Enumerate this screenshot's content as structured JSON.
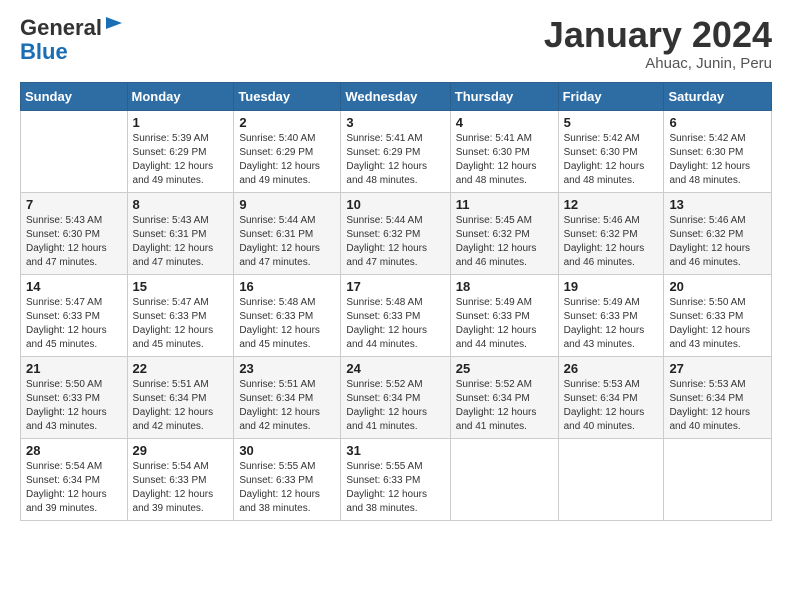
{
  "logo": {
    "general": "General",
    "blue": "Blue"
  },
  "title": "January 2024",
  "location": "Ahuac, Junin, Peru",
  "days_header": [
    "Sunday",
    "Monday",
    "Tuesday",
    "Wednesday",
    "Thursday",
    "Friday",
    "Saturday"
  ],
  "weeks": [
    [
      {
        "num": "",
        "info": ""
      },
      {
        "num": "1",
        "info": "Sunrise: 5:39 AM\nSunset: 6:29 PM\nDaylight: 12 hours\nand 49 minutes."
      },
      {
        "num": "2",
        "info": "Sunrise: 5:40 AM\nSunset: 6:29 PM\nDaylight: 12 hours\nand 49 minutes."
      },
      {
        "num": "3",
        "info": "Sunrise: 5:41 AM\nSunset: 6:29 PM\nDaylight: 12 hours\nand 48 minutes."
      },
      {
        "num": "4",
        "info": "Sunrise: 5:41 AM\nSunset: 6:30 PM\nDaylight: 12 hours\nand 48 minutes."
      },
      {
        "num": "5",
        "info": "Sunrise: 5:42 AM\nSunset: 6:30 PM\nDaylight: 12 hours\nand 48 minutes."
      },
      {
        "num": "6",
        "info": "Sunrise: 5:42 AM\nSunset: 6:30 PM\nDaylight: 12 hours\nand 48 minutes."
      }
    ],
    [
      {
        "num": "7",
        "info": "Sunrise: 5:43 AM\nSunset: 6:30 PM\nDaylight: 12 hours\nand 47 minutes."
      },
      {
        "num": "8",
        "info": "Sunrise: 5:43 AM\nSunset: 6:31 PM\nDaylight: 12 hours\nand 47 minutes."
      },
      {
        "num": "9",
        "info": "Sunrise: 5:44 AM\nSunset: 6:31 PM\nDaylight: 12 hours\nand 47 minutes."
      },
      {
        "num": "10",
        "info": "Sunrise: 5:44 AM\nSunset: 6:32 PM\nDaylight: 12 hours\nand 47 minutes."
      },
      {
        "num": "11",
        "info": "Sunrise: 5:45 AM\nSunset: 6:32 PM\nDaylight: 12 hours\nand 46 minutes."
      },
      {
        "num": "12",
        "info": "Sunrise: 5:46 AM\nSunset: 6:32 PM\nDaylight: 12 hours\nand 46 minutes."
      },
      {
        "num": "13",
        "info": "Sunrise: 5:46 AM\nSunset: 6:32 PM\nDaylight: 12 hours\nand 46 minutes."
      }
    ],
    [
      {
        "num": "14",
        "info": "Sunrise: 5:47 AM\nSunset: 6:33 PM\nDaylight: 12 hours\nand 45 minutes."
      },
      {
        "num": "15",
        "info": "Sunrise: 5:47 AM\nSunset: 6:33 PM\nDaylight: 12 hours\nand 45 minutes."
      },
      {
        "num": "16",
        "info": "Sunrise: 5:48 AM\nSunset: 6:33 PM\nDaylight: 12 hours\nand 45 minutes."
      },
      {
        "num": "17",
        "info": "Sunrise: 5:48 AM\nSunset: 6:33 PM\nDaylight: 12 hours\nand 44 minutes."
      },
      {
        "num": "18",
        "info": "Sunrise: 5:49 AM\nSunset: 6:33 PM\nDaylight: 12 hours\nand 44 minutes."
      },
      {
        "num": "19",
        "info": "Sunrise: 5:49 AM\nSunset: 6:33 PM\nDaylight: 12 hours\nand 43 minutes."
      },
      {
        "num": "20",
        "info": "Sunrise: 5:50 AM\nSunset: 6:33 PM\nDaylight: 12 hours\nand 43 minutes."
      }
    ],
    [
      {
        "num": "21",
        "info": "Sunrise: 5:50 AM\nSunset: 6:33 PM\nDaylight: 12 hours\nand 43 minutes."
      },
      {
        "num": "22",
        "info": "Sunrise: 5:51 AM\nSunset: 6:34 PM\nDaylight: 12 hours\nand 42 minutes."
      },
      {
        "num": "23",
        "info": "Sunrise: 5:51 AM\nSunset: 6:34 PM\nDaylight: 12 hours\nand 42 minutes."
      },
      {
        "num": "24",
        "info": "Sunrise: 5:52 AM\nSunset: 6:34 PM\nDaylight: 12 hours\nand 41 minutes."
      },
      {
        "num": "25",
        "info": "Sunrise: 5:52 AM\nSunset: 6:34 PM\nDaylight: 12 hours\nand 41 minutes."
      },
      {
        "num": "26",
        "info": "Sunrise: 5:53 AM\nSunset: 6:34 PM\nDaylight: 12 hours\nand 40 minutes."
      },
      {
        "num": "27",
        "info": "Sunrise: 5:53 AM\nSunset: 6:34 PM\nDaylight: 12 hours\nand 40 minutes."
      }
    ],
    [
      {
        "num": "28",
        "info": "Sunrise: 5:54 AM\nSunset: 6:34 PM\nDaylight: 12 hours\nand 39 minutes."
      },
      {
        "num": "29",
        "info": "Sunrise: 5:54 AM\nSunset: 6:33 PM\nDaylight: 12 hours\nand 39 minutes."
      },
      {
        "num": "30",
        "info": "Sunrise: 5:55 AM\nSunset: 6:33 PM\nDaylight: 12 hours\nand 38 minutes."
      },
      {
        "num": "31",
        "info": "Sunrise: 5:55 AM\nSunset: 6:33 PM\nDaylight: 12 hours\nand 38 minutes."
      },
      {
        "num": "",
        "info": ""
      },
      {
        "num": "",
        "info": ""
      },
      {
        "num": "",
        "info": ""
      }
    ]
  ]
}
